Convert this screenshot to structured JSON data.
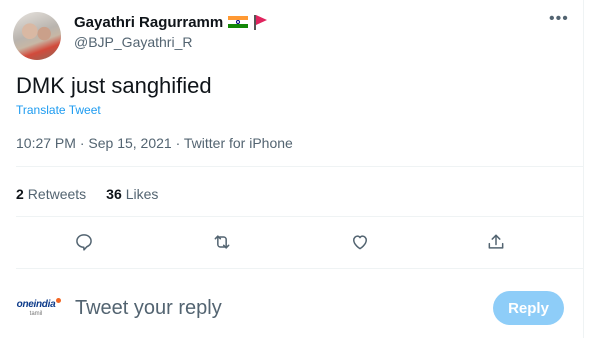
{
  "author": {
    "display_name": "Gayathri Ragurramm",
    "handle": "@BJP_Gayathri_R"
  },
  "tweet": {
    "text": "DMK just sanghified",
    "translate_label": "Translate Tweet",
    "time": "10:27 PM",
    "date": "Sep 15, 2021",
    "source": "Twitter for iPhone"
  },
  "stats": {
    "retweets_count": "2",
    "retweets_label": "Retweets",
    "likes_count": "36",
    "likes_label": "Likes"
  },
  "reply": {
    "avatar_brand": "oneindia",
    "avatar_sub": "tamil",
    "placeholder": "Tweet your reply",
    "button_label": "Reply"
  },
  "colors": {
    "accent": "#1d9bf0",
    "reply_button_disabled": "#8ecdf8",
    "muted_text": "#536471"
  },
  "icons": [
    "more-icon",
    "reply-icon",
    "retweet-icon",
    "like-icon",
    "share-icon",
    "india-flag-icon",
    "pennant-icon"
  ]
}
